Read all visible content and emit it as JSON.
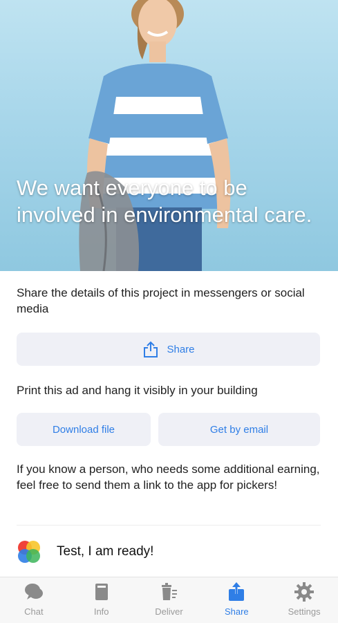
{
  "hero": {
    "title": "We want everyone to be involved in environmental care."
  },
  "share_section": {
    "text": "Share the details of this project in messengers or social media",
    "share_button_label": "Share"
  },
  "print_section": {
    "text": "Print this ad and hang it visibly in your building",
    "download_label": "Download file",
    "email_label": "Get by email"
  },
  "invite_section": {
    "text": "If you know a person, who needs some additional earning, feel free to send them a link to the app for pickers!"
  },
  "ready": {
    "label": "Test, I am ready!"
  },
  "tabbar": {
    "items": [
      {
        "label": "Chat",
        "icon": "chat-icon"
      },
      {
        "label": "Info",
        "icon": "book-icon"
      },
      {
        "label": "Deliver",
        "icon": "trash-icon"
      },
      {
        "label": "Share",
        "icon": "share-icon",
        "active": true
      },
      {
        "label": "Settings",
        "icon": "gear-icon"
      }
    ]
  },
  "colors": {
    "accent": "#2f7ee6",
    "button_bg": "#eff0f6",
    "tab_inactive": "#9a9a9a"
  }
}
